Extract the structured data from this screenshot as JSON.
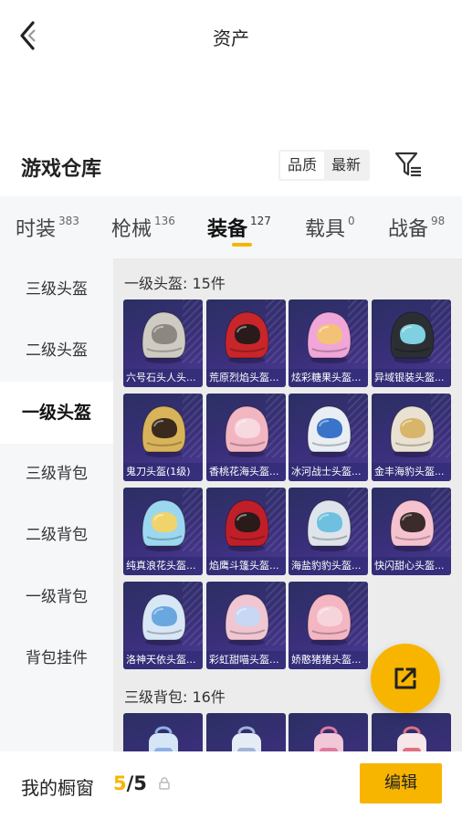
{
  "header": {
    "title": "资产",
    "back_icon": "chevron-left-icon"
  },
  "warehouse": {
    "title": "游戏仓库",
    "sort_options": [
      "品质",
      "最新"
    ],
    "filter_icon": "filter-icon"
  },
  "tabs": [
    {
      "label": "时装",
      "count": "383"
    },
    {
      "label": "枪械",
      "count": "136"
    },
    {
      "label": "装备",
      "count": "127"
    },
    {
      "label": "载具",
      "count": "0"
    },
    {
      "label": "战备",
      "count": "98"
    }
  ],
  "active_tab": "装备",
  "sidebar": {
    "items": [
      "三级头盔",
      "二级头盔",
      "一级头盔",
      "三级背包",
      "二级背包",
      "一级背包",
      "背包挂件"
    ],
    "active": "一级头盔"
  },
  "sections": [
    {
      "title": "一级头盔: 15件",
      "items": [
        "六号石头人头...",
        "荒原烈焰头盔...",
        "炫彩糖果头盔...",
        "异域银装头盔...",
        "鬼刀头盔(1级)",
        "香桃花海头盔...",
        "冰河战士头盔...",
        "金丰海豹头盔...",
        "纯真浪花头盔...",
        "焰鹰斗篷头盔...",
        "海盐豹豹头盔...",
        "快闪甜心头盔...",
        "洛神天依头盔...",
        "彩虹甜喵头盔...",
        "娇憨猪猪头盔..."
      ]
    },
    {
      "title": "三级背包: 16件",
      "items": []
    }
  ],
  "colors": {
    "accent": "#f7b500",
    "card_bg": "#3a2f7a",
    "helmets": [
      [
        "#cfcbc2",
        "#8c8780"
      ],
      [
        "#c8262a",
        "#2a1b1b"
      ],
      [
        "#f0a6d8",
        "#f3c276"
      ],
      [
        "#2b2f33",
        "#7fd0e0"
      ],
      [
        "#d9b35a",
        "#3a2a1e"
      ],
      [
        "#f2b6c2",
        "#f7d9e0"
      ],
      [
        "#e9eef4",
        "#3a74c9"
      ],
      [
        "#e9e2d2",
        "#d7b56b"
      ],
      [
        "#9bd8f0",
        "#f0d36a"
      ],
      [
        "#c01f2a",
        "#2a1a1a"
      ],
      [
        "#dfe4ea",
        "#6ec0df"
      ],
      [
        "#f6c2cf",
        "#3b2b2b"
      ],
      [
        "#d8e7f6",
        "#6aa7df"
      ],
      [
        "#f0c6d2",
        "#c7d7f4"
      ],
      [
        "#f4b6c2",
        "#f7d4dc"
      ]
    ]
  },
  "bottom": {
    "label": "我的橱窗",
    "current": "5",
    "total": "/5",
    "edit": "编辑"
  },
  "fab_icon": "share-export-icon"
}
